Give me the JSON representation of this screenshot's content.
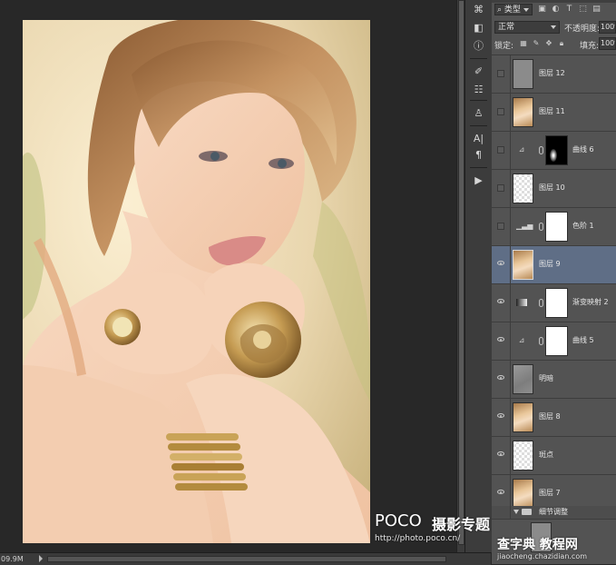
{
  "status_bar": {
    "doc_size": "09.9M"
  },
  "layers_panel": {
    "filter": {
      "kind": "类型",
      "icons": [
        "pixel-filter-icon",
        "adjustment-filter-icon",
        "type-filter-icon",
        "shape-filter-icon",
        "smart-object-filter-icon"
      ]
    },
    "blend_mode": "正常",
    "opacity_label": "不透明度:",
    "opacity_value": "100%",
    "lock_label": "锁定:",
    "fill_label": "填充:",
    "fill_value": "100%",
    "layers": [
      {
        "name": "图层 12",
        "visible": false,
        "thumb": "gray"
      },
      {
        "name": "图层 11",
        "visible": false,
        "thumb": "photo"
      },
      {
        "name": "曲线 6",
        "visible": false,
        "adjustment_icon": "curves-icon",
        "mask": "black"
      },
      {
        "name": "图层 10",
        "visible": false,
        "thumb": "transparent"
      },
      {
        "name": "色阶 1",
        "visible": false,
        "adjustment_icon": "levels-icon",
        "mask": "white"
      },
      {
        "name": "图层 9",
        "visible": true,
        "thumb": "photo",
        "selected": true
      },
      {
        "name": "渐变映射 2",
        "visible": true,
        "adjustment_icon": "gradient-map-icon",
        "mask": "white"
      },
      {
        "name": "曲线 5",
        "visible": true,
        "adjustment_icon": "curves-icon",
        "mask": "white"
      },
      {
        "name": "明暗",
        "visible": true,
        "thumb": "gray-texture"
      },
      {
        "name": "图层 8",
        "visible": true,
        "thumb": "photo"
      },
      {
        "name": "斑点",
        "visible": true,
        "thumb": "transparent"
      },
      {
        "name": "图层 7",
        "visible": true,
        "thumb": "photo"
      }
    ],
    "group": {
      "name": "细节调整"
    }
  },
  "watermarks": {
    "poco": "POCO",
    "poco_cn": "摄影专题",
    "poco_url": "http://photo.poco.cn/",
    "chazidian": "查字典 教程网",
    "chazidian_url": "jiaocheng.chazidian.com"
  },
  "colors": {
    "canvas_bg": "#282828",
    "panel_bg": "#535353",
    "selected_layer": "#5f6e86"
  }
}
